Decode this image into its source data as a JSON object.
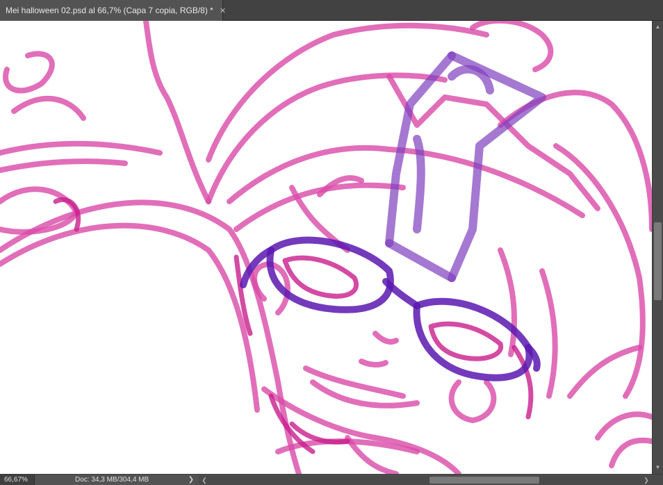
{
  "document_tab": {
    "title": "Mei halloween 02.psd al 66,7% (Capa 7 copia, RGB/8) *",
    "close_glyph": "✕"
  },
  "status_bar": {
    "zoom": "66,67%",
    "doc_info": "Doc: 34,3 MB/304,4 MB",
    "menu_arrow": "❯"
  },
  "scrollbars": {
    "up_glyph": "▲",
    "down_glyph": "▼",
    "left_glyph": "❮",
    "right_glyph": "❯"
  },
  "colors": {
    "canvas": "#ffffff",
    "sketch_pink": "#d94aa8",
    "sketch_magenta": "#c81e8c",
    "sketch_purple": "#7f3fbf",
    "glasses_purple": "#5a17b0",
    "ui_dark": "#535353"
  }
}
